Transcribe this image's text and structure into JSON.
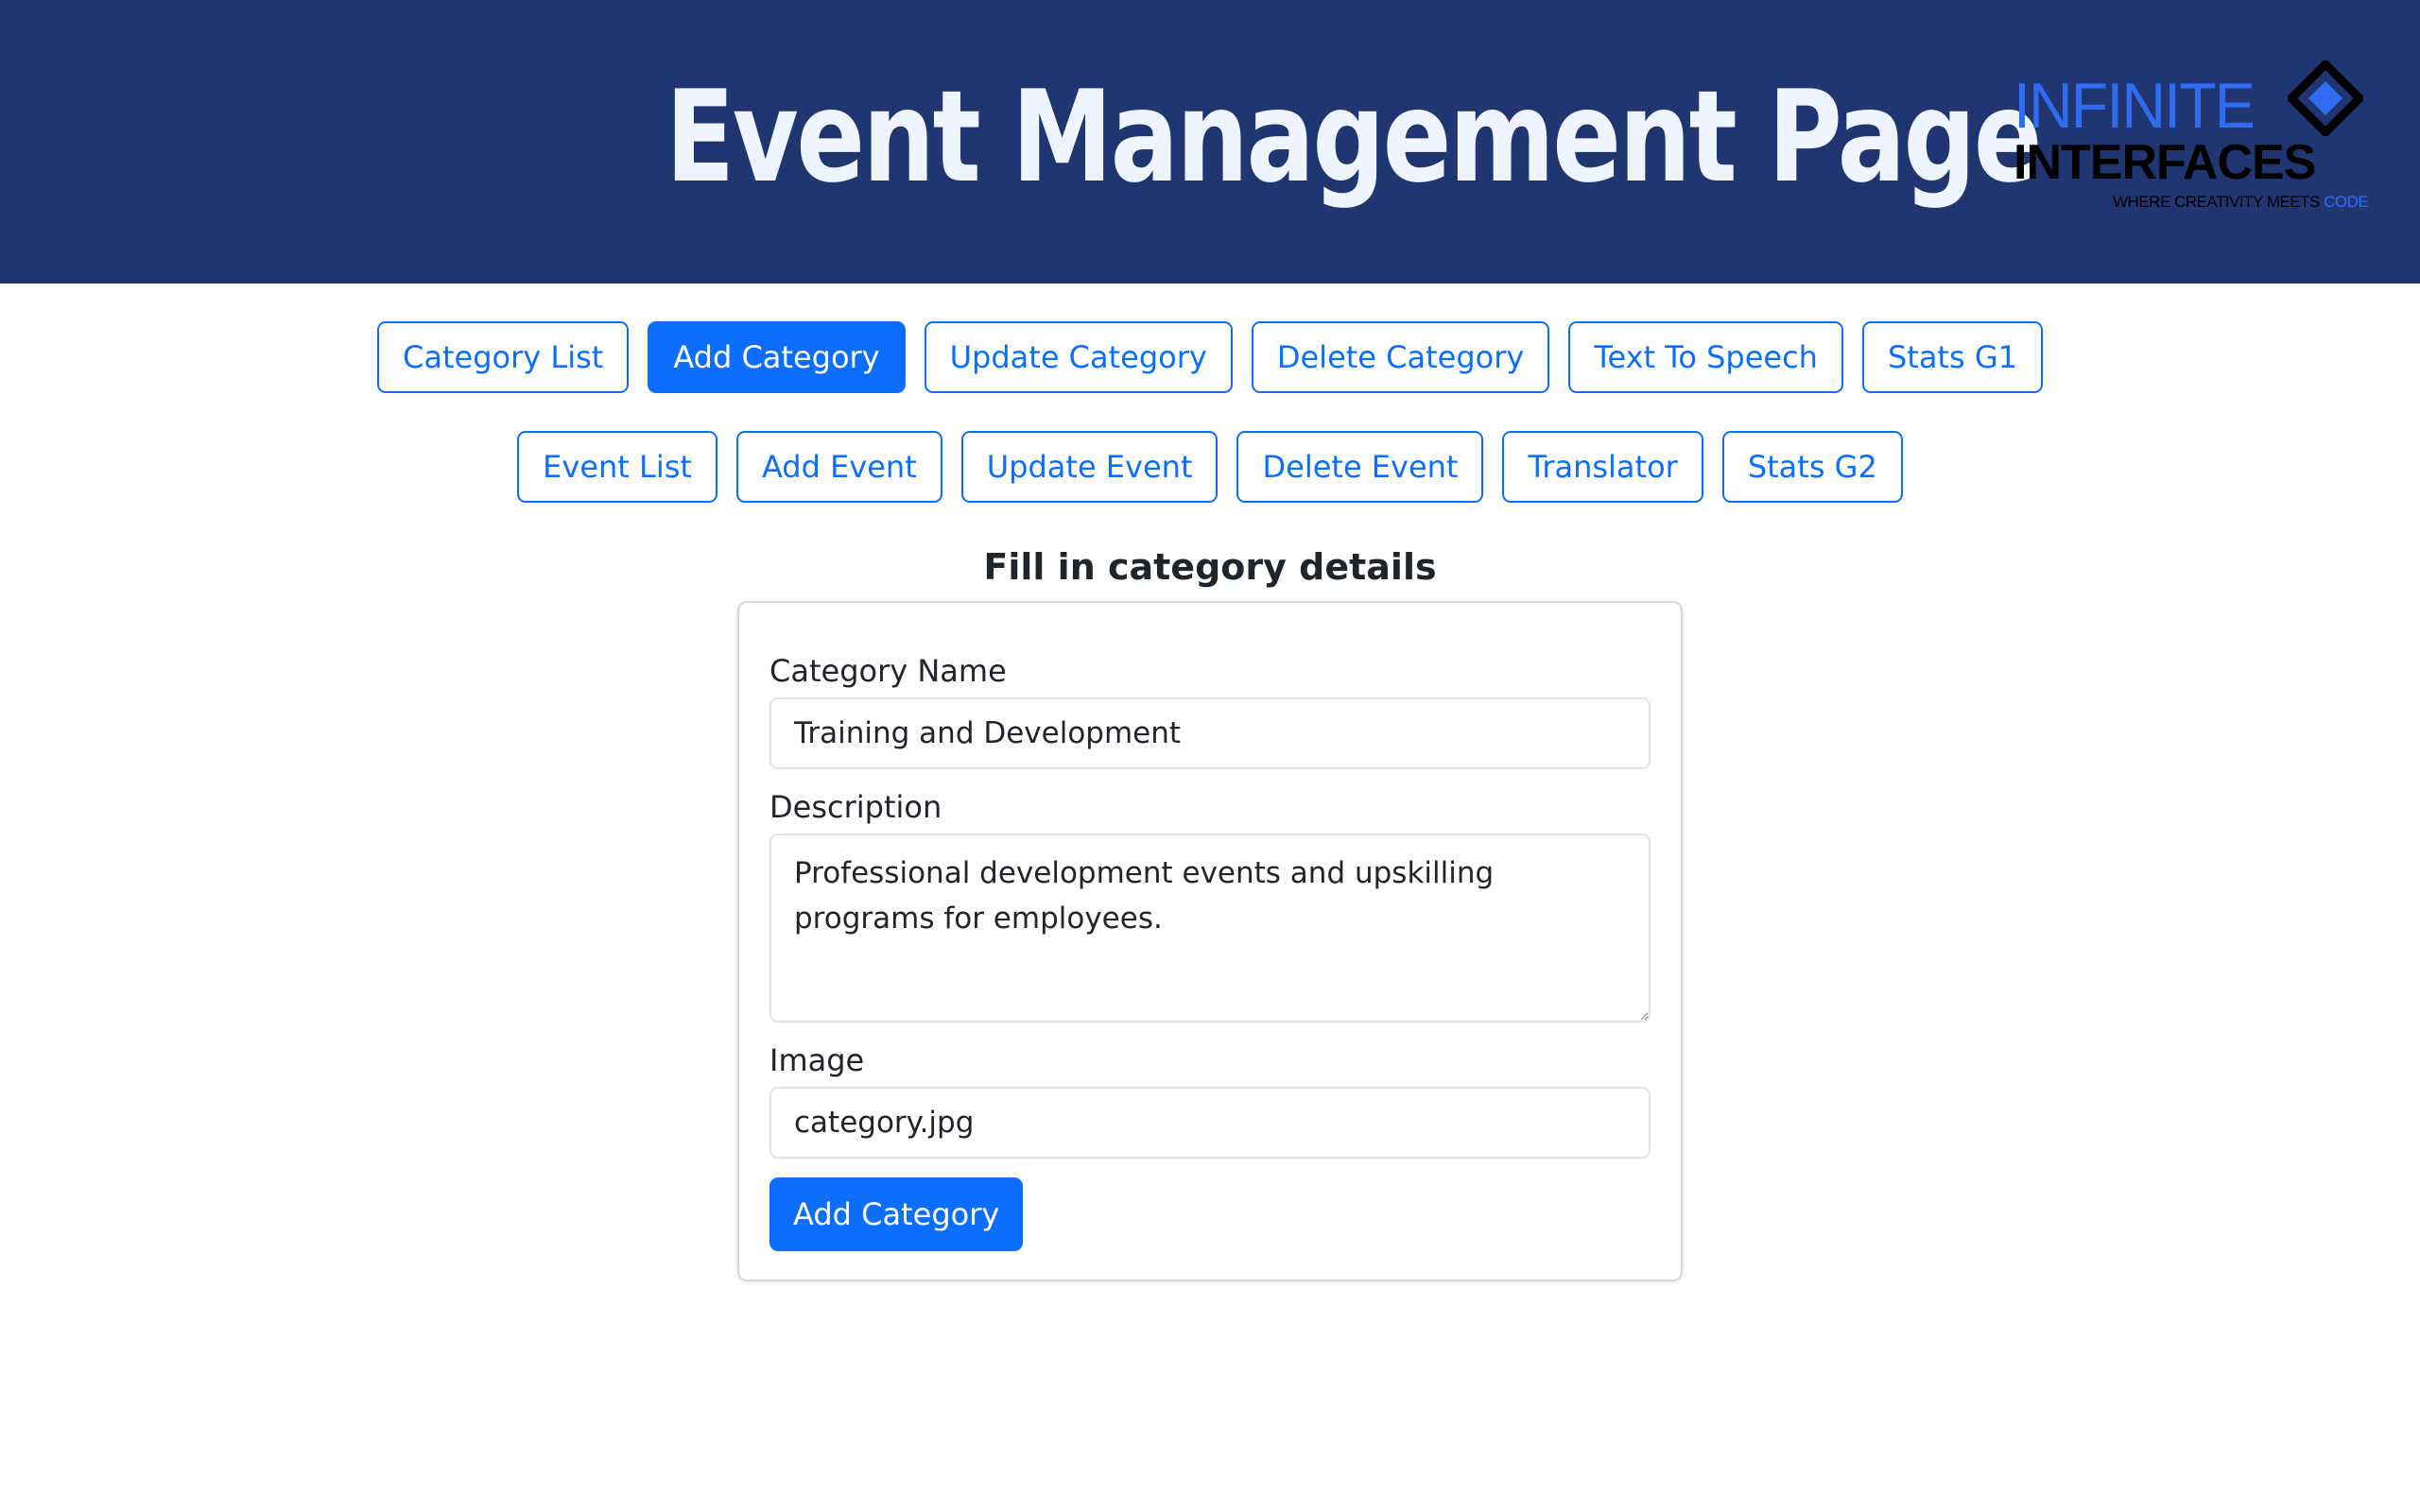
{
  "header": {
    "title": "Event Management Page",
    "logo": {
      "line1": "INFINITE",
      "line2": "INTERFACES",
      "tagline": "WHERE CREATIVITY MEETS",
      "tagline_accent": "CODE"
    }
  },
  "nav": {
    "row1": [
      "Category List",
      "Add Category",
      "Update Category",
      "Delete Category",
      "Text To Speech",
      "Stats G1"
    ],
    "row2": [
      "Event List",
      "Add Event",
      "Update Event",
      "Delete Event",
      "Translator",
      "Stats G2"
    ],
    "active": "Add Category"
  },
  "form": {
    "heading": "Fill in category details",
    "name_label": "Category Name",
    "name_value": "Training and Development",
    "description_label": "Description",
    "description_value": "Professional development events and upskilling programs for employees.",
    "image_label": "Image",
    "image_value": "category.jpg",
    "submit_label": "Add Category"
  },
  "colors": {
    "header_bg": "#213671",
    "primary": "#0d6efd",
    "logo_blue": "#2f6cf0"
  }
}
